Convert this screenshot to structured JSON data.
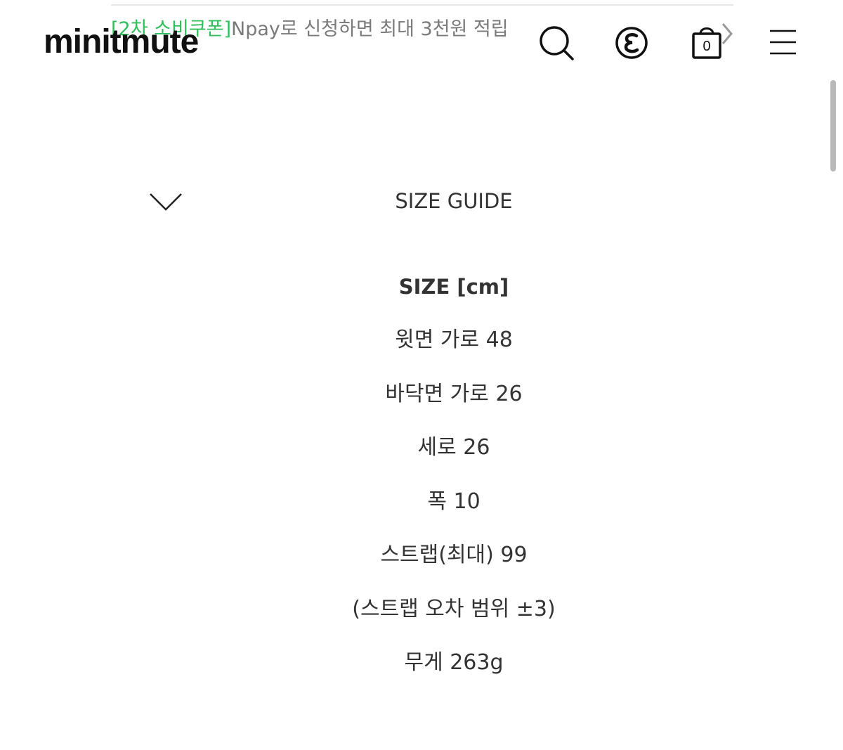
{
  "notice": {
    "tag": "[2차 소비쿠폰]",
    "text": "Npay로 신청하면 최대 3천원 적립"
  },
  "header": {
    "logo": "minitmute",
    "search_icon": "search-icon",
    "e_icon": "e-circle-icon",
    "cart_icon": "shopping-bag-icon",
    "cart_count": "0",
    "menu_icon": "hamburger-menu-icon"
  },
  "section": {
    "toggle_icon": "chevron-down-icon",
    "title": "SIZE GUIDE"
  },
  "size_guide": {
    "heading": "SIZE [cm]",
    "rows": [
      "윗면 가로 48",
      "바닥면 가로 26",
      "세로 26",
      "폭 10",
      "스트랩(최대) 99",
      "(스트랩 오차 범위 ±3)",
      "무게 263g"
    ]
  },
  "colors": {
    "coupon_tag": "#2fbf5b",
    "notice_text": "#7a7a7a",
    "body_text": "#333333",
    "icon": "#111111"
  }
}
